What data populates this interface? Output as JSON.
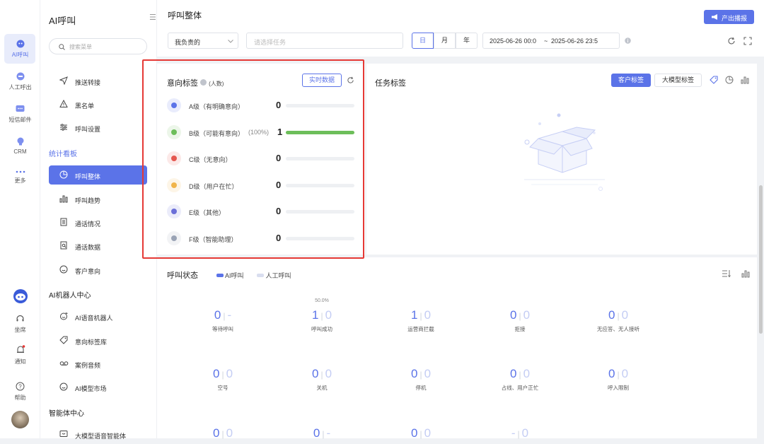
{
  "rail": {
    "items": [
      {
        "label": "AI呼叫",
        "icon": "ai-call-icon"
      },
      {
        "label": "人工呼出",
        "icon": "manual-call-icon"
      },
      {
        "label": "短信邮件",
        "icon": "sms-email-icon"
      },
      {
        "label": "CRM",
        "icon": "crm-icon"
      },
      {
        "label": "更多",
        "icon": "more-icon"
      }
    ],
    "bottom": [
      {
        "label": "坐席",
        "icon": "headset-icon"
      },
      {
        "label": "通知",
        "icon": "bell-icon"
      },
      {
        "label": "帮助",
        "icon": "help-icon"
      }
    ],
    "accent": "#5b73e8"
  },
  "sidebar": {
    "title": "AI呼叫",
    "search_placeholder": "搜索菜单",
    "items_top": [
      "推送转接",
      "黑名单",
      "呼叫设置"
    ],
    "group_stats": "统计看板",
    "stats_items": [
      "呼叫整体",
      "呼叫趋势",
      "通话情况",
      "通话数据",
      "客户意向"
    ],
    "group_robot": "AI机器人中心",
    "robot_items": [
      "AI语音机器人",
      "意向标签库",
      "案例音频",
      "AI模型市场"
    ],
    "group_agent": "智能体中心",
    "agent_items": [
      "大模型语音智能体"
    ]
  },
  "header": {
    "title": "呼叫整体",
    "broadcast_label": "产出播报",
    "owner_select": "我负责的",
    "task_placeholder": "请选择任务",
    "seg_day": "日",
    "seg_month": "月",
    "seg_year": "年",
    "date_start": "2025-06-26 00:0",
    "date_sep": "~",
    "date_end": "2025-06-26 23:5"
  },
  "intent": {
    "title": "意向标签",
    "unit": "(人数)",
    "realtime_button": "实时数据",
    "levels": [
      {
        "label": "A级（有明确意向）",
        "pct": "",
        "count": "0",
        "ratio": 0,
        "color": "#5b73e8"
      },
      {
        "label": "B级（可能有意向）",
        "pct": "(100%)",
        "count": "1",
        "ratio": 1,
        "color": "#6dbe5a"
      },
      {
        "label": "C级（无意向）",
        "pct": "",
        "count": "0",
        "ratio": 0,
        "color": "#e5574f"
      },
      {
        "label": "D级（用户在忙）",
        "pct": "",
        "count": "0",
        "ratio": 0,
        "color": "#f0b44a"
      },
      {
        "label": "E级（其他）",
        "pct": "",
        "count": "0",
        "ratio": 0,
        "color": "#6b6fd8"
      },
      {
        "label": "F级（智能助理）",
        "pct": "",
        "count": "0",
        "ratio": 0,
        "color": "#9aa3b5"
      }
    ]
  },
  "task": {
    "title": "任务标签",
    "btn_customer": "客户标签",
    "btn_model": "大模型标签"
  },
  "call_status": {
    "title": "呼叫状态",
    "legend_ai": "AI呼叫",
    "legend_manual": "人工呼叫",
    "stats": [
      {
        "a": "0",
        "b": "-",
        "label": "等待呼叫",
        "pct": ""
      },
      {
        "a": "1",
        "b": "0",
        "label": "呼叫成功",
        "pct": "50.0%"
      },
      {
        "a": "1",
        "b": "0",
        "label": "运营商拦截",
        "pct": ""
      },
      {
        "a": "0",
        "b": "0",
        "label": "拒接",
        "pct": ""
      },
      {
        "a": "0",
        "b": "0",
        "label": "无应答、无人接听",
        "pct": ""
      },
      {
        "a": "0",
        "b": "0",
        "label": "空号",
        "pct": ""
      },
      {
        "a": "0",
        "b": "0",
        "label": "关机",
        "pct": ""
      },
      {
        "a": "0",
        "b": "0",
        "label": "停机",
        "pct": ""
      },
      {
        "a": "0",
        "b": "0",
        "label": "占线、用户正忙",
        "pct": ""
      },
      {
        "a": "0",
        "b": "0",
        "label": "呼入限制",
        "pct": ""
      },
      {
        "a": "0",
        "b": "0",
        "label": "",
        "pct": ""
      },
      {
        "a": "0",
        "b": "-",
        "label": "",
        "pct": ""
      },
      {
        "a": "0",
        "b": "0",
        "label": "",
        "pct": ""
      },
      {
        "a": "-",
        "b": "0",
        "label": "",
        "pct": ""
      }
    ]
  }
}
